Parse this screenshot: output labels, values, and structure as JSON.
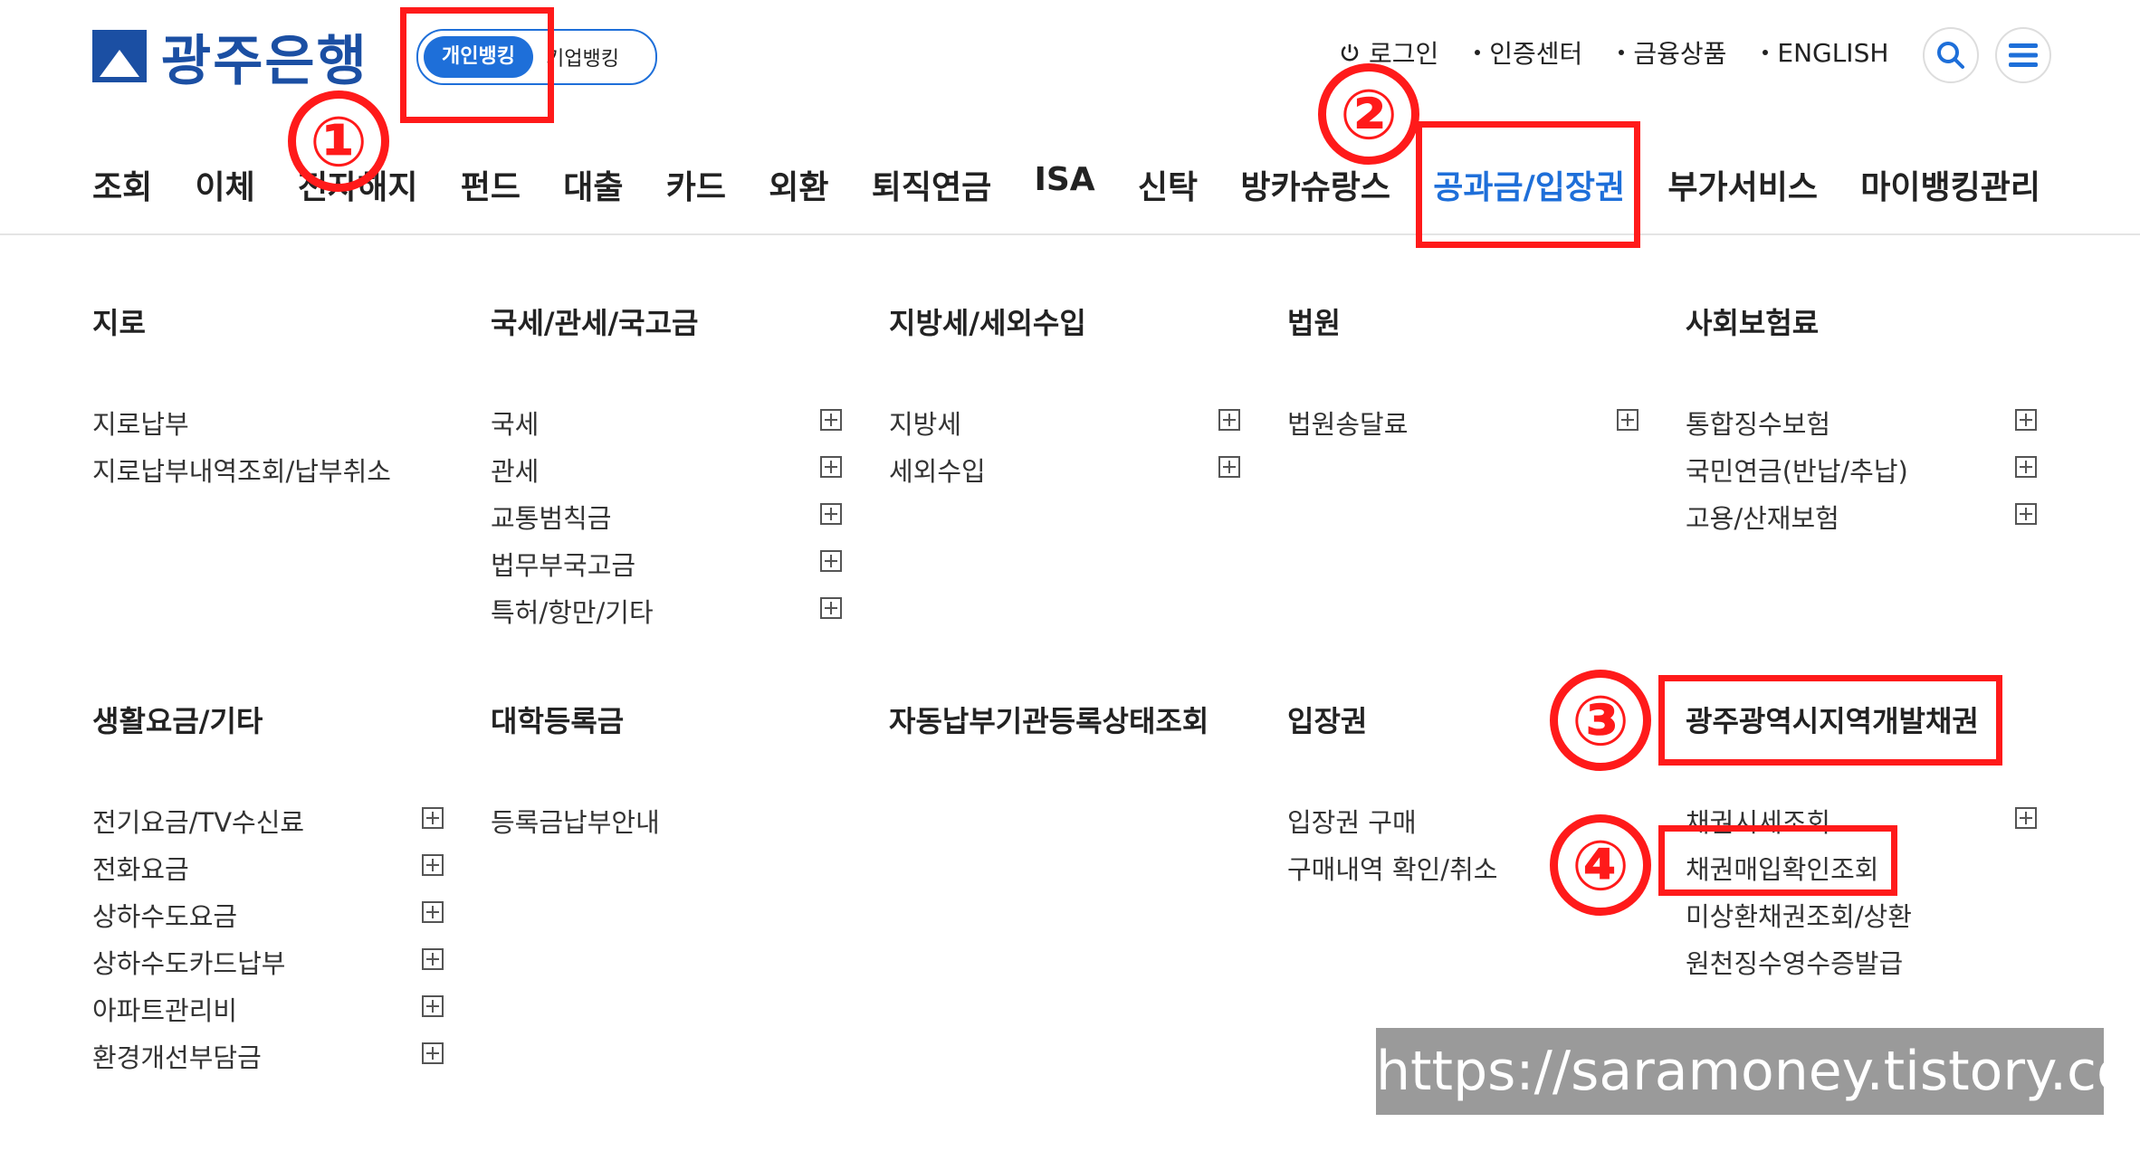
{
  "header": {
    "logo_text": "광주은행",
    "bank_toggle": {
      "active": "개인뱅킹",
      "inactive": "기업뱅킹"
    },
    "top_links": [
      "로그인",
      "인증센터",
      "금융상품",
      "ENGLISH"
    ]
  },
  "gnb": [
    "조회",
    "이체",
    "전자해지",
    "펀드",
    "대출",
    "카드",
    "외환",
    "퇴직연금",
    "ISA",
    "신탁",
    "방카슈랑스",
    "공과금/입장권",
    "부가서비스",
    "마이뱅킹관리"
  ],
  "menu": {
    "giro": {
      "title": "지로",
      "items": [
        "지로납부",
        "지로납부내역조회/납부취소"
      ]
    },
    "national_tax": {
      "title": "국세/관세/국고금",
      "items": [
        "국세",
        "관세",
        "교통범칙금",
        "법무부국고금",
        "특허/항만/기타"
      ]
    },
    "local_tax": {
      "title": "지방세/세외수입",
      "items": [
        "지방세",
        "세외수입"
      ]
    },
    "court": {
      "title": "법원",
      "items": [
        "법원송달료"
      ]
    },
    "social": {
      "title": "사회보험료",
      "items": [
        "통합징수보험",
        "국민연금(반납/추납)",
        "고용/산재보험"
      ]
    },
    "living": {
      "title": "생활요금/기타",
      "items": [
        "전기요금/TV수신료",
        "전화요금",
        "상하수도요금",
        "상하수도카드납부",
        "아파트관리비",
        "환경개선부담금"
      ]
    },
    "tuition": {
      "title": "대학등록금",
      "items": [
        "등록금납부안내"
      ]
    },
    "auto_pay": {
      "title": "자동납부기관등록상태조회"
    },
    "ticket": {
      "title": "입장권",
      "items": [
        "입장권 구매",
        "구매내역 확인/취소"
      ]
    },
    "bond": {
      "title": "광주광역시지역개발채권",
      "items": [
        "채권시세조회",
        "채권매입확인조회",
        "미상환채권조회/상환",
        "원천징수영수증발급"
      ]
    }
  },
  "annotations": [
    "①",
    "②",
    "③",
    "④"
  ],
  "watermark": "https://saramoney.tistory.com",
  "colors": {
    "accent": "#1e6fd9",
    "annotation": "#ff1a1a",
    "brand": "#1b4fa3"
  }
}
